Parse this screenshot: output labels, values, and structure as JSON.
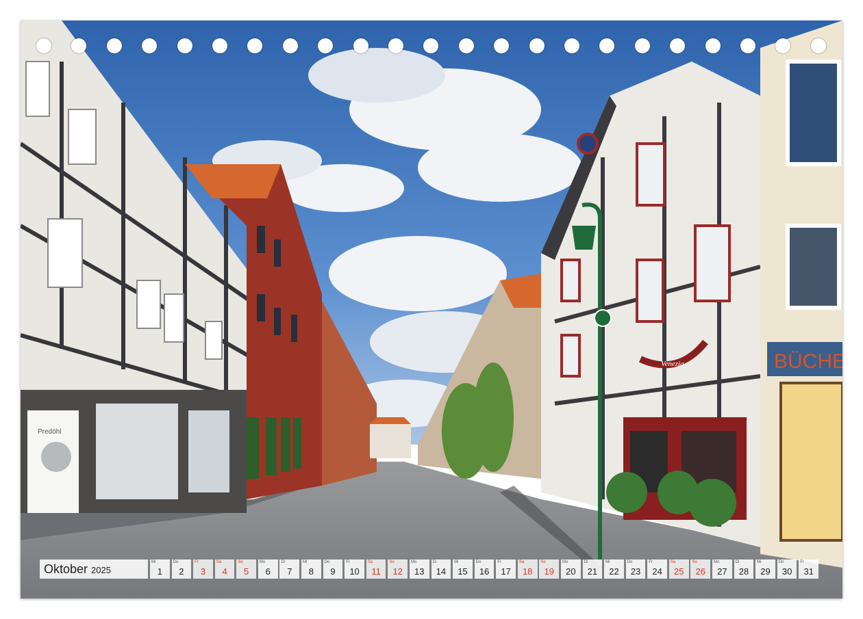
{
  "calendar": {
    "month": "Oktober",
    "year": "2025",
    "days": [
      {
        "wd": "Mi",
        "d": "1",
        "we": false
      },
      {
        "wd": "Do",
        "d": "2",
        "we": false
      },
      {
        "wd": "Fr",
        "d": "3",
        "we": true
      },
      {
        "wd": "Sa",
        "d": "4",
        "we": true
      },
      {
        "wd": "So",
        "d": "5",
        "we": true
      },
      {
        "wd": "Mo",
        "d": "6",
        "we": false
      },
      {
        "wd": "Di",
        "d": "7",
        "we": false
      },
      {
        "wd": "Mi",
        "d": "8",
        "we": false
      },
      {
        "wd": "Do",
        "d": "9",
        "we": false
      },
      {
        "wd": "Fr",
        "d": "10",
        "we": false
      },
      {
        "wd": "Sa",
        "d": "11",
        "we": true
      },
      {
        "wd": "So",
        "d": "12",
        "we": true
      },
      {
        "wd": "Mo",
        "d": "13",
        "we": false
      },
      {
        "wd": "Di",
        "d": "14",
        "we": false
      },
      {
        "wd": "Mi",
        "d": "15",
        "we": false
      },
      {
        "wd": "Do",
        "d": "16",
        "we": false
      },
      {
        "wd": "Fr",
        "d": "17",
        "we": false
      },
      {
        "wd": "Sa",
        "d": "18",
        "we": true
      },
      {
        "wd": "So",
        "d": "19",
        "we": true
      },
      {
        "wd": "Mo",
        "d": "20",
        "we": false
      },
      {
        "wd": "Di",
        "d": "21",
        "we": false
      },
      {
        "wd": "Mi",
        "d": "22",
        "we": false
      },
      {
        "wd": "Do",
        "d": "23",
        "we": false
      },
      {
        "wd": "Fr",
        "d": "24",
        "we": false
      },
      {
        "wd": "Sa",
        "d": "25",
        "we": true
      },
      {
        "wd": "So",
        "d": "26",
        "we": true
      },
      {
        "wd": "Mo",
        "d": "27",
        "we": false
      },
      {
        "wd": "Di",
        "d": "28",
        "we": false
      },
      {
        "wd": "Mi",
        "d": "29",
        "we": false
      },
      {
        "wd": "Do",
        "d": "30",
        "we": false
      },
      {
        "wd": "Fr",
        "d": "31",
        "we": false
      }
    ]
  },
  "photo_text": {
    "shop_sign": "BÜCHE",
    "optician_sign": "Predöhl",
    "restaurant_sign": "Venezia"
  },
  "binding_holes": 23,
  "colors": {
    "sky": "#3f78c4",
    "cloud": "#f2f4f7",
    "timber": "#3a3a3e",
    "plaster": "#eceae4",
    "brick": "#9b3426",
    "roof": "#d4682e",
    "cobble": "#8d8f93",
    "lamp_green": "#1f6b3a",
    "weekend_red": "#d9341c"
  }
}
